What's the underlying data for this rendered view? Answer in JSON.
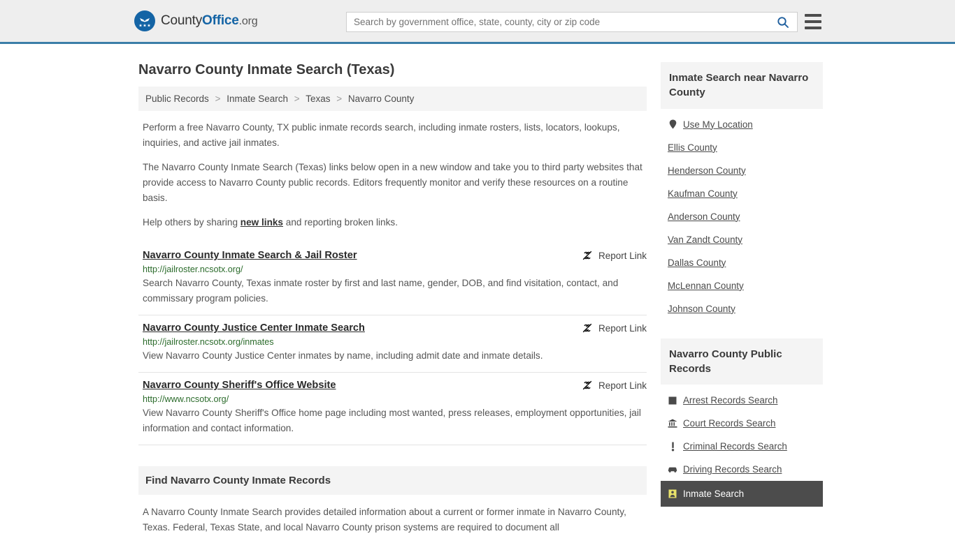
{
  "header": {
    "brand": {
      "part1": "County",
      "part2": "Office",
      "part3": ".org",
      "logo_icon": "eagle-shield-icon"
    },
    "search": {
      "placeholder": "Search by government office, state, county, city or zip code",
      "value": "",
      "button_icon": "search-icon"
    },
    "menu_icon": "hamburger-menu-icon",
    "accent_color": "#1464a5",
    "border_color": "#3b7ea8"
  },
  "page_title": "Navarro County Inmate Search (Texas)",
  "breadcrumb": {
    "items": [
      "Public Records",
      "Inmate Search",
      "Texas",
      "Navarro County"
    ],
    "separator": ">"
  },
  "intro": {
    "p1": "Perform a free Navarro County, TX public inmate records search, including inmate rosters, lists, locators, lookups, inquiries, and active jail inmates.",
    "p2": "The Navarro County Inmate Search (Texas) links below open in a new window and take you to third party websites that provide access to Navarro County public records. Editors frequently monitor and verify these resources on a routine basis.",
    "p3_before": "Help others by sharing ",
    "p3_link": "new links",
    "p3_after": " and reporting broken links."
  },
  "results": [
    {
      "title": "Navarro County Inmate Search & Jail Roster",
      "url": "http://jailroster.ncsotx.org/",
      "description": "Search Navarro County, Texas inmate roster by first and last name, gender, DOB, and find visitation, contact, and commissary program policies.",
      "report_label": "Report Link",
      "report_icon": "broken-link-icon"
    },
    {
      "title": "Navarro County Justice Center Inmate Search",
      "url": "http://jailroster.ncsotx.org/inmates",
      "description": "View Navarro County Justice Center inmates by name, including admit date and inmate details.",
      "report_label": "Report Link",
      "report_icon": "broken-link-icon"
    },
    {
      "title": "Navarro County Sheriff's Office Website",
      "url": "http://www.ncsotx.org/",
      "description": "View Navarro County Sheriff's Office home page including most wanted, press releases, employment opportunities, jail information and contact information.",
      "report_label": "Report Link",
      "report_icon": "broken-link-icon"
    }
  ],
  "bottom_section": {
    "heading": "Find Navarro County Inmate Records",
    "paragraph": "A Navarro County Inmate Search provides detailed information about a current or former inmate in Navarro County, Texas. Federal, Texas State, and local Navarro County prison systems are required to document all"
  },
  "sidebar": {
    "nearby": {
      "heading": "Inmate Search near Navarro County",
      "items": [
        {
          "label": "Use My Location",
          "icon": "map-pin-icon"
        },
        {
          "label": "Ellis County",
          "icon": ""
        },
        {
          "label": "Henderson County",
          "icon": ""
        },
        {
          "label": "Kaufman County",
          "icon": ""
        },
        {
          "label": "Anderson County",
          "icon": ""
        },
        {
          "label": "Van Zandt County",
          "icon": ""
        },
        {
          "label": "Dallas County",
          "icon": ""
        },
        {
          "label": "McLennan County",
          "icon": ""
        },
        {
          "label": "Johnson County",
          "icon": ""
        }
      ]
    },
    "public_records": {
      "heading": "Navarro County Public Records",
      "items": [
        {
          "label": "Arrest Records Search",
          "icon": "square-icon",
          "active": false
        },
        {
          "label": "Court Records Search",
          "icon": "courthouse-icon",
          "active": false
        },
        {
          "label": "Criminal Records Search",
          "icon": "exclamation-icon",
          "active": false
        },
        {
          "label": "Driving Records Search",
          "icon": "car-icon",
          "active": false
        },
        {
          "label": "Inmate Search",
          "icon": "inmate-icon",
          "active": true
        }
      ]
    }
  }
}
